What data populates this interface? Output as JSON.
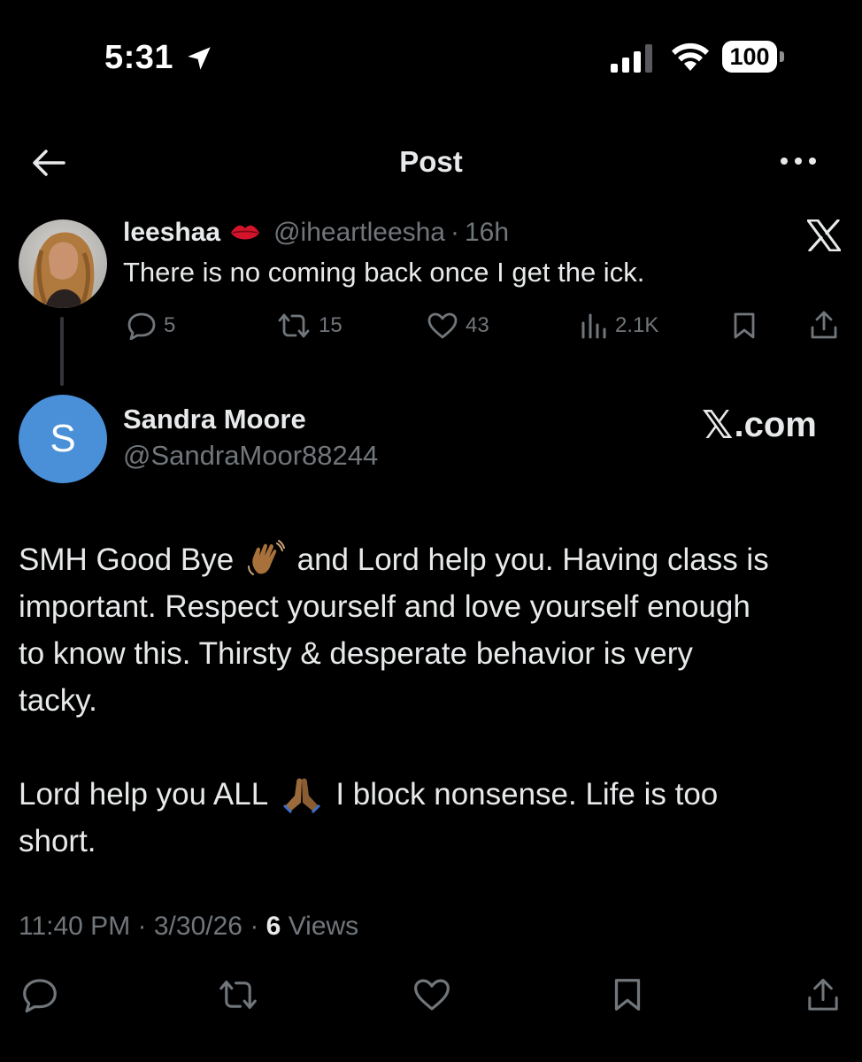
{
  "status_bar": {
    "time": "5:31",
    "battery": "100"
  },
  "nav": {
    "title": "Post"
  },
  "quoted_post": {
    "display_name": "leeshaa",
    "handle": "@iheartleesha",
    "separator": "·",
    "age": "16h",
    "text": "There is no coming back once I get the ick.",
    "replies": "5",
    "reposts": "15",
    "likes": "43",
    "views": "2.1K"
  },
  "main_post": {
    "avatar_letter": "S",
    "display_name": "Sandra Moore",
    "handle": "@SandraMoor88244",
    "watermark_x": "𝕏",
    "watermark_rest": ".com",
    "line1_a": "SMH Good Bye",
    "line1_b": "and Lord help you. Having class is",
    "line2": "important. Respect yourself and love yourself enough",
    "line3": "to know this.  Thirsty & desperate behavior is very",
    "line4": "tacky.",
    "line5_a": "Lord help you ALL",
    "line5_b": "I block nonsense. Life is too",
    "line6": "short.",
    "time": "11:40 PM",
    "date": "3/30/26",
    "separator": "·",
    "views_count": "6",
    "views_label": "Views"
  },
  "colors": {
    "background": "#000000",
    "text": "#e7e9ea",
    "muted": "#71767b",
    "avatar_blue": "#4a90d9"
  }
}
